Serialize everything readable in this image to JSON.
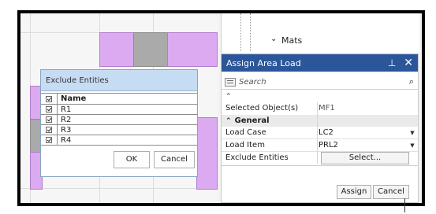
{
  "tree": {
    "chevron": "⌄",
    "item": "Mats"
  },
  "assign_panel": {
    "title": "Assign Area Load",
    "pin_icon": "⊥",
    "close_icon": "✕",
    "search_placeholder": "Search",
    "search_icon": "⌕",
    "collapse_caret": "⌃",
    "rows": {
      "selected_objects": {
        "label": "Selected Object(s)",
        "value": "MF1"
      },
      "general": {
        "label": "General",
        "caret": "⌃"
      },
      "load_case": {
        "label": "Load Case",
        "value": "LC2"
      },
      "load_item": {
        "label": "Load Item",
        "value": "PRL2"
      },
      "exclude_entities": {
        "label": "Exclude Entities",
        "button": "Select..."
      }
    },
    "dropdown_icon": "▼",
    "assign_button": "Assign",
    "cancel_button": "Cancel"
  },
  "exclude_dialog": {
    "title": "Exclude Entities",
    "column_name": "Name",
    "rows": [
      "R1",
      "R2",
      "R3",
      "R4"
    ],
    "ok_button": "OK",
    "cancel_button": "Cancel"
  }
}
